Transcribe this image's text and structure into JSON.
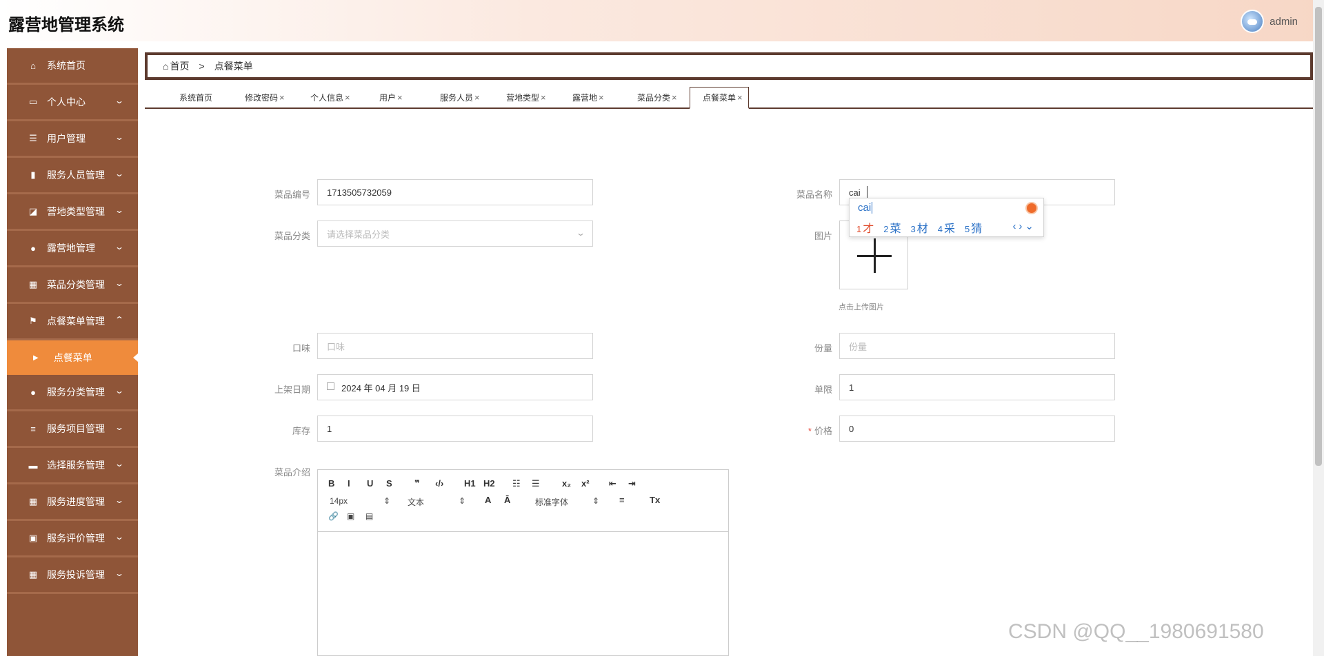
{
  "app": {
    "title": "露营地管理系统",
    "username": "admin"
  },
  "sidebar": {
    "items": [
      {
        "label": "系统首页",
        "icon": "home-icon",
        "glyph": "⌂",
        "chevron": ""
      },
      {
        "label": "个人中心",
        "icon": "card-icon",
        "glyph": "▭",
        "chevron": "⌄"
      },
      {
        "label": "用户管理",
        "icon": "sliders-icon",
        "glyph": "☰",
        "chevron": "⌄"
      },
      {
        "label": "服务人员管理",
        "icon": "bar-chart-icon",
        "glyph": "▮",
        "chevron": "⌄"
      },
      {
        "label": "营地类型管理",
        "icon": "line-chart-icon",
        "glyph": "◪",
        "chevron": "⌄"
      },
      {
        "label": "露营地管理",
        "icon": "user-icon",
        "glyph": "●",
        "chevron": "⌄"
      },
      {
        "label": "菜品分类管理",
        "icon": "grid-icon",
        "glyph": "▦",
        "chevron": "⌄"
      },
      {
        "label": "点餐菜单管理",
        "icon": "flag-icon",
        "glyph": "⚑",
        "chevron": "⌃"
      }
    ],
    "submenu": {
      "label": "点餐菜单",
      "glyph": "▶"
    },
    "items_after": [
      {
        "label": "服务分类管理",
        "icon": "bulb-icon",
        "glyph": "●",
        "chevron": "⌄"
      },
      {
        "label": "服务项目管理",
        "icon": "list-icon",
        "glyph": "≡",
        "chevron": "⌄"
      },
      {
        "label": "选择服务管理",
        "icon": "chat-icon",
        "glyph": "▬",
        "chevron": "⌄"
      },
      {
        "label": "服务进度管理",
        "icon": "grid-icon",
        "glyph": "▦",
        "chevron": "⌄"
      },
      {
        "label": "服务评价管理",
        "icon": "clipboard-check-icon",
        "glyph": "▣",
        "chevron": "⌄"
      },
      {
        "label": "服务投诉管理",
        "icon": "grid-icon",
        "glyph": "▦",
        "chevron": "⌄"
      }
    ]
  },
  "breadcrumb": {
    "home": "首页",
    "separator": ">",
    "current": "点餐菜单"
  },
  "tabs": [
    {
      "label": "系统首页",
      "close": ""
    },
    {
      "label": "修改密码",
      "close": "×"
    },
    {
      "label": "个人信息",
      "close": "×"
    },
    {
      "label": "用户",
      "close": "×"
    },
    {
      "label": "服务人员",
      "close": "×"
    },
    {
      "label": "营地类型",
      "close": "×"
    },
    {
      "label": "露营地",
      "close": "×"
    },
    {
      "label": "菜品分类",
      "close": "×"
    },
    {
      "label": "点餐菜单",
      "close": "×",
      "active": true
    }
  ],
  "form": {
    "code": {
      "label": "菜品编号",
      "value": "1713505732059"
    },
    "name": {
      "label": "菜品名称",
      "value": "cai"
    },
    "category": {
      "label": "菜品分类",
      "placeholder": "请选择菜品分类"
    },
    "image": {
      "label": "图片",
      "hint": "点击上传图片"
    },
    "taste": {
      "label": "口味",
      "placeholder": "口味"
    },
    "portion": {
      "label": "份量",
      "placeholder": "份量"
    },
    "date": {
      "label": "上架日期",
      "value": "2024 年 04 月 19 日"
    },
    "limit": {
      "label": "单限",
      "value": "1"
    },
    "stock": {
      "label": "库存",
      "value": "1"
    },
    "price": {
      "label": "价格",
      "required_mark": "*",
      "value": "0"
    },
    "intro": {
      "label": "菜品介绍"
    }
  },
  "ime": {
    "input": "cai",
    "candidates": [
      {
        "num": "1",
        "text": "才"
      },
      {
        "num": "2",
        "text": "菜"
      },
      {
        "num": "3",
        "text": "材"
      },
      {
        "num": "4",
        "text": "采"
      },
      {
        "num": "5",
        "text": "猜"
      }
    ],
    "nav": "‹›⌄"
  },
  "editor": {
    "row1": [
      "B",
      "I",
      "U",
      "S",
      "❞",
      "‹/›",
      "H1",
      "H2",
      "☷",
      "☰",
      "x₂",
      "x²",
      "⇤",
      "⇥"
    ],
    "font_size": "14px",
    "format": "文本",
    "font_family": "标准字体",
    "row2_icons": [
      "A",
      "Ā",
      "≡",
      "Tx"
    ],
    "row3_icons": [
      "🔗",
      "▣",
      "▤"
    ]
  },
  "watermark": "CSDN @QQ__1980691580"
}
